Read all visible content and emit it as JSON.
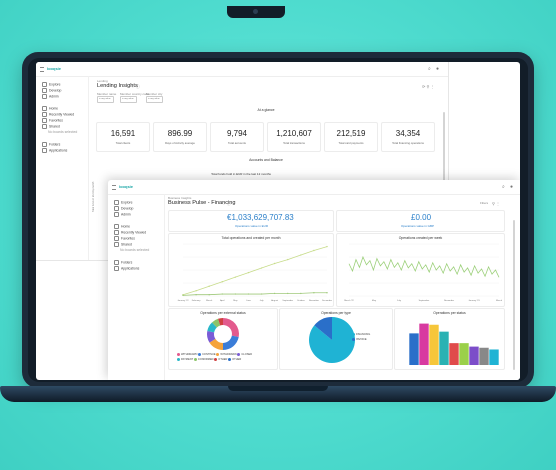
{
  "colors": {
    "accent": "#1aa6a6",
    "blue": "#2a7fc9",
    "line": "#a9d08a"
  },
  "sidebar": {
    "items": [
      "Explore",
      "Develop",
      "Admin",
      "Home",
      "Recently Viewed",
      "Favorites",
      "Shared",
      "No boards selected",
      "Folders",
      "Applications"
    ]
  },
  "win1": {
    "brand": "looqsie",
    "breadcrumb": "Lending",
    "title": "Lending Insights",
    "filters": [
      {
        "label": "Member name",
        "value": "is any value"
      },
      {
        "label": "Member country code",
        "value": "is any value"
      },
      {
        "label": "Member city",
        "value": "is any value"
      }
    ],
    "section_glance": "At a glance",
    "kpis": [
      {
        "value": "16,591",
        "label": "Total clients"
      },
      {
        "value": "896.99",
        "label": "Days of Activity average"
      },
      {
        "value": "9,794",
        "label": "Total accounts"
      },
      {
        "value": "1,210,607",
        "label": "Total transactions"
      },
      {
        "value": "212,519",
        "label": "Total card payments"
      },
      {
        "value": "34,354",
        "label": "Total financing operations"
      }
    ],
    "section_accounts": "Accounts and Balance",
    "subsection": "Total funds hold in EUR in the last 12 months",
    "side_caption": "Total funds in EUR by month"
  },
  "win2": {
    "brand": "looqsie",
    "breadcrumb": "Business Insights",
    "title": "Business Pulse - Financing",
    "filter_label": "Filters",
    "value1": "€1,033,629,707.83",
    "value1_label": "Operations value in EUR",
    "value2": "£0.00",
    "value2_label": "Operations value in GBP",
    "chart1_title": "Total operations and created per month",
    "chart2_title": "Operations created per week",
    "chart1_months": [
      "January '22",
      "February",
      "March",
      "April",
      "May",
      "June",
      "July",
      "August",
      "September",
      "October",
      "November",
      "December"
    ],
    "chart2_months": [
      "March '22",
      "May",
      "July",
      "September",
      "November",
      "January '23",
      "March"
    ],
    "chart3_title": "Operations per external status",
    "chart4_title": "Operations per type",
    "chart5_title": "Operations per status",
    "donut_legend": [
      "WITHDRAWN",
      "CONTINUE",
      "WITHDRAWN",
      "CLOSED",
      "PAYMENT",
      "CONFIRMED",
      "OTHER",
      "OTHER"
    ],
    "pie_legend": [
      "FINANCING",
      "INVOICE"
    ]
  },
  "chart_data": [
    {
      "type": "line",
      "title": "Total operations and created per month",
      "categories": [
        "January '22",
        "February",
        "March",
        "April",
        "May",
        "June",
        "July",
        "August",
        "September",
        "October",
        "November",
        "December"
      ],
      "series": [
        {
          "values": [
            2,
            8,
            15,
            22,
            29,
            36,
            43,
            50,
            56,
            63,
            70,
            76
          ]
        },
        {
          "values": [
            1,
            2,
            2,
            3,
            3,
            3,
            3,
            4,
            4,
            4,
            5,
            5
          ]
        }
      ],
      "ylim": [
        0,
        80
      ]
    },
    {
      "type": "line",
      "title": "Operations created per week",
      "series": [
        {
          "values": [
            62,
            48,
            70,
            55,
            75,
            60,
            68,
            50,
            72,
            58,
            66,
            52,
            70,
            55,
            64,
            50,
            68,
            54,
            62,
            48,
            66,
            52,
            60,
            46,
            64,
            50,
            58,
            44,
            62,
            48,
            56,
            42,
            60,
            46,
            54,
            40,
            58,
            44,
            52,
            38,
            56,
            42,
            50,
            36
          ]
        }
      ],
      "ylim": [
        0,
        100
      ]
    },
    {
      "type": "pie",
      "title": "Operations per external status",
      "values": [
        28,
        22,
        16,
        12,
        10,
        7,
        5
      ],
      "colors": [
        "#e35a8d",
        "#3b7dd8",
        "#f5a33b",
        "#7a5bd6",
        "#29b7c9",
        "#8cc46a",
        "#d04040"
      ]
    },
    {
      "type": "pie",
      "title": "Operations per type",
      "values": [
        86,
        14
      ],
      "colors": [
        "#1fb3d4",
        "#2a6fc9"
      ]
    },
    {
      "type": "bar",
      "title": "Operations per status",
      "values": [
        55,
        72,
        70,
        58,
        38,
        38,
        32,
        30,
        27
      ],
      "colors": [
        "#2a6fc9",
        "#d83aa0",
        "#f6c63a",
        "#2ab2b3",
        "#e04b4b",
        "#9bd04a",
        "#7c4dc9",
        "#888888",
        "#1fb3d4"
      ],
      "ylim": [
        0,
        80
      ]
    }
  ]
}
